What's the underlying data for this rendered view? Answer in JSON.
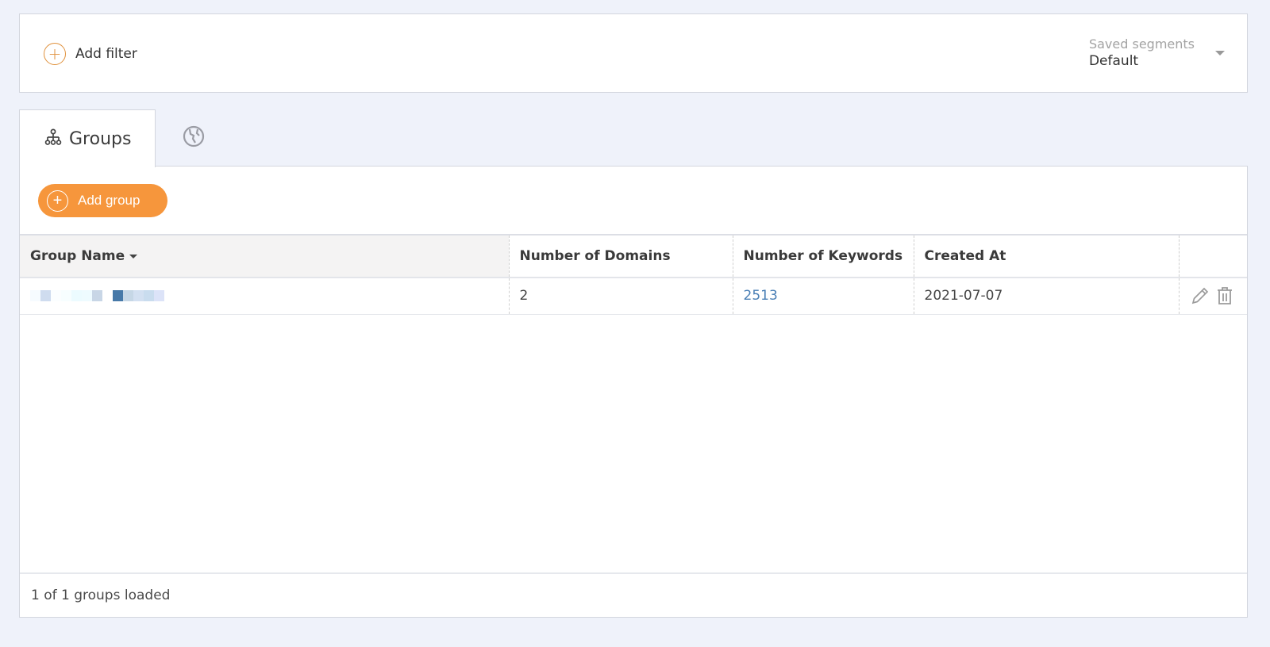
{
  "filter_bar": {
    "add_filter_label": "Add filter",
    "saved_segments_caption": "Saved segments",
    "saved_segments_value": "Default"
  },
  "tabs": [
    {
      "label": "Groups",
      "icon": "sitemap-icon",
      "active": true
    },
    {
      "label": "",
      "icon": "globe-icon",
      "active": false
    }
  ],
  "toolbar": {
    "add_group_label": "Add group"
  },
  "table": {
    "columns": [
      "Group Name",
      "Number of Domains",
      "Number of Keywords",
      "Created At",
      ""
    ],
    "sorted_column": "Group Name",
    "rows": [
      {
        "group_name": "[redacted]",
        "domains": "2",
        "keywords": "2513",
        "created_at": "2021-07-07"
      }
    ]
  },
  "footer": {
    "status": "1 of 1 groups loaded"
  },
  "colors": {
    "accent": "#f6963c",
    "link": "#4a7fb5",
    "background": "#eff2fa"
  }
}
